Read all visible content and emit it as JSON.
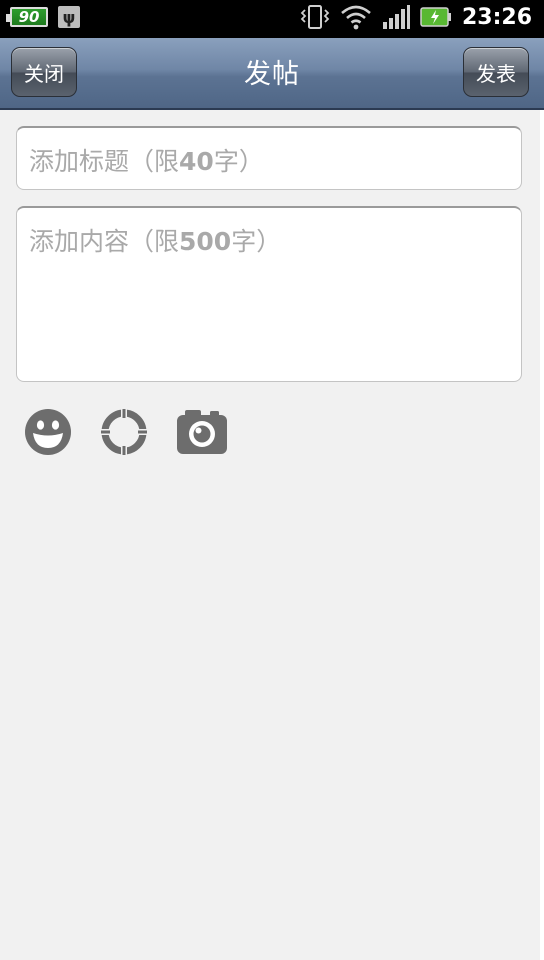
{
  "statusbar": {
    "battery_level": "90",
    "time": "23:26"
  },
  "titlebar": {
    "title": "发帖",
    "close_label": "关闭",
    "post_label": "发表"
  },
  "form": {
    "title_placeholder_prefix": "添加标题（限",
    "title_placeholder_limit": "40",
    "title_placeholder_suffix": "字）",
    "content_placeholder_prefix": "添加内容（限",
    "content_placeholder_limit": "500",
    "content_placeholder_suffix": "字）"
  },
  "tools": [
    "emoji-icon",
    "location-icon",
    "camera-icon"
  ],
  "colors": {
    "titlebar_top": "#8aa0bd",
    "titlebar_bottom": "#4f6686",
    "background": "#f1f1f1",
    "placeholder": "#a9a9a9",
    "icon_gray": "#6d6d6d"
  }
}
